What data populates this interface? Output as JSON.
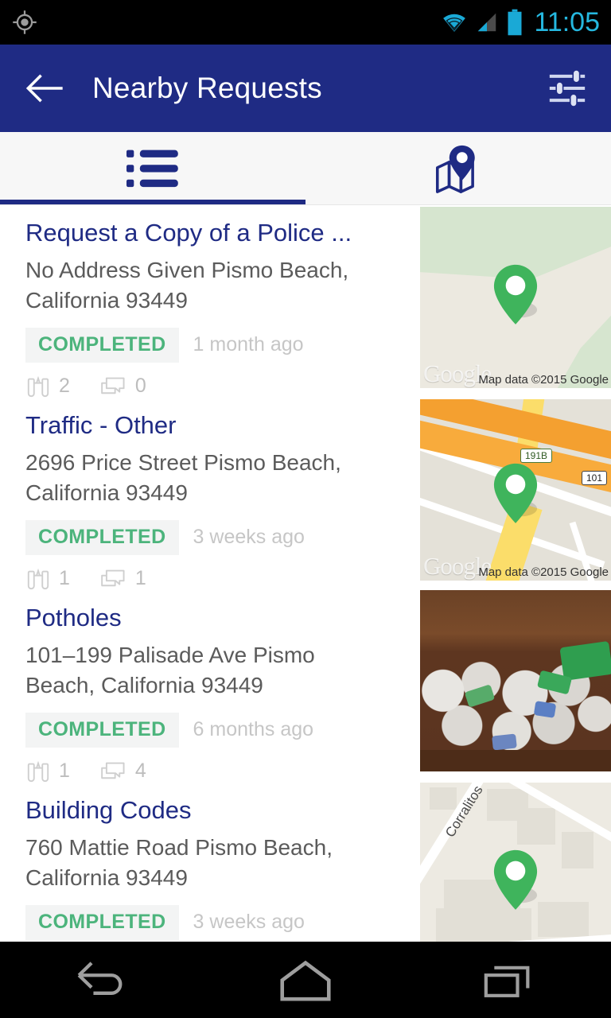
{
  "status_bar": {
    "left_icon": "gps-fixed-icon",
    "icons": [
      "wifi-icon",
      "cellular-signal-icon",
      "battery-icon"
    ],
    "time": "11:05",
    "time_color": "#25b8e0"
  },
  "app_bar": {
    "back_icon": "arrow-back-icon",
    "title": "Nearby Requests",
    "filter_icon": "filter-sliders-icon",
    "background": "#1f2b84"
  },
  "tabs": [
    {
      "id": "list",
      "icon": "list-icon",
      "label": "List",
      "active": true
    },
    {
      "id": "map",
      "icon": "map-pin-icon",
      "label": "Map",
      "active": false
    }
  ],
  "theme": {
    "accent": "#1f2b84",
    "status_completed": "#4cb47c",
    "badge_bg": "#f3f4f4",
    "muted_text": "#c6c6c6",
    "address_text": "#5b5b5b"
  },
  "list": {
    "items": [
      {
        "title": "Request a Copy of a Police ...",
        "address": "No Address Given Pismo Beach, California 93449",
        "status": "COMPLETED",
        "time_ago": "1 month ago",
        "views_icon": "binoculars-icon",
        "views": "2",
        "comments_icon": "comments-icon",
        "comments": "0",
        "thumb_type": "map",
        "thumb_variant": "coast",
        "thumb_attribution": "Map data ©2015 Google",
        "thumb_logo": "Google",
        "thumb_labels": []
      },
      {
        "title": "Traffic - Other",
        "address": "2696  Price Street Pismo Beach, California 93449",
        "status": "COMPLETED",
        "time_ago": "3 weeks ago",
        "views_icon": "binoculars-icon",
        "views": "1",
        "comments_icon": "comments-icon",
        "comments": "1",
        "thumb_type": "map",
        "thumb_variant": "highway",
        "thumb_attribution": "Map data ©2015 Google",
        "thumb_logo": "Google",
        "thumb_labels": [
          "191B",
          "101"
        ]
      },
      {
        "title": "Potholes",
        "address": "101–199  Palisade Ave Pismo Beach, California 93449",
        "status": "COMPLETED",
        "time_ago": "6 months ago",
        "views_icon": "binoculars-icon",
        "views": "1",
        "comments_icon": "comments-icon",
        "comments": "4",
        "thumb_type": "photo",
        "thumb_variant": "trash-cans",
        "thumb_attribution": "",
        "thumb_logo": "",
        "thumb_labels": []
      },
      {
        "title": "Building Codes",
        "address": "760  Mattie Road Pismo Beach, California 93449",
        "status": "COMPLETED",
        "time_ago": "3 weeks ago",
        "views_icon": "binoculars-icon",
        "views": "",
        "comments_icon": "comments-icon",
        "comments": "",
        "thumb_type": "map",
        "thumb_variant": "street",
        "thumb_attribution": "",
        "thumb_logo": "",
        "thumb_labels": [
          "Corralitos"
        ]
      }
    ]
  },
  "nav_bar": {
    "back": "nav-back-icon",
    "home": "nav-home-icon",
    "recents": "nav-recents-icon"
  }
}
